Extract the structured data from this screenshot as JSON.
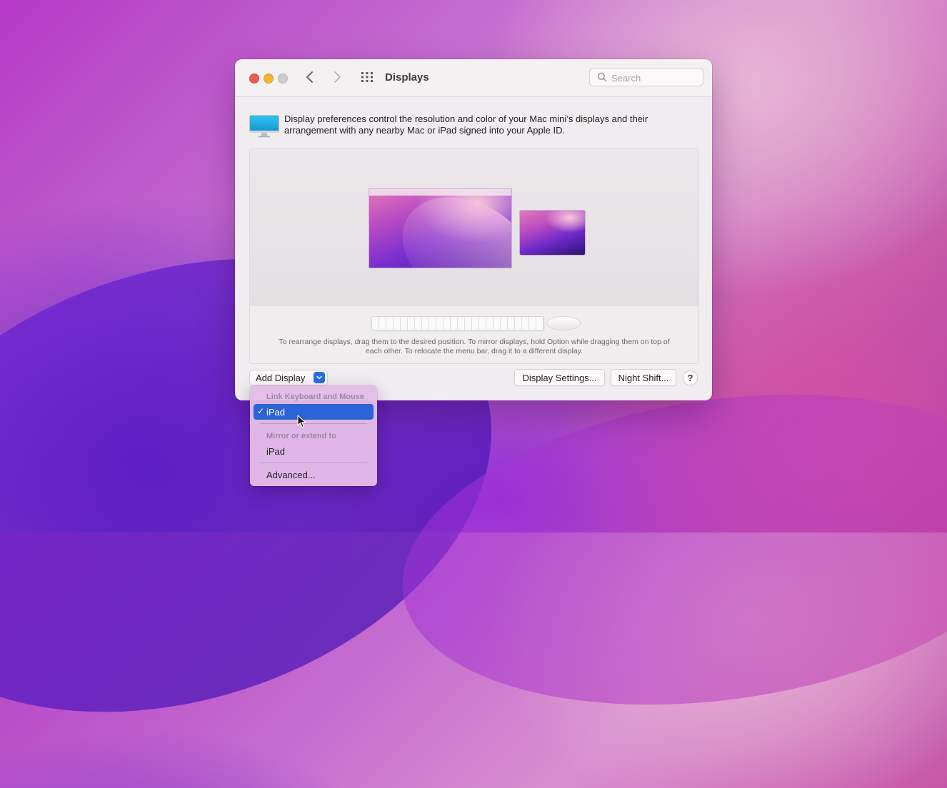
{
  "window": {
    "title": "Displays",
    "search_placeholder": "Search"
  },
  "intro": {
    "text": "Display preferences control the resolution and color of your Mac mini’s displays and their arrangement with any nearby Mac or iPad signed into your Apple ID."
  },
  "arrangement": {
    "hint": "To rearrange displays, drag them to the desired position. To mirror displays, hold Option while dragging them on top of each other. To relocate the menu bar, drag it to a different display."
  },
  "toolbar": {
    "add_display_label": "Add Display",
    "display_settings_label": "Display Settings...",
    "night_shift_label": "Night Shift...",
    "help_label": "?"
  },
  "menu": {
    "header_link": "Link Keyboard and Mouse",
    "item_link_ipad": "iPad",
    "header_mirror": "Mirror or extend to",
    "item_mirror_ipad": "iPad",
    "item_advanced": "Advanced...",
    "check_glyph": "✓"
  },
  "colors": {
    "accent": "#2a64d8",
    "close": "#ee5b55",
    "minimize": "#f2b62f",
    "menu_bg": "#e4bce8"
  }
}
